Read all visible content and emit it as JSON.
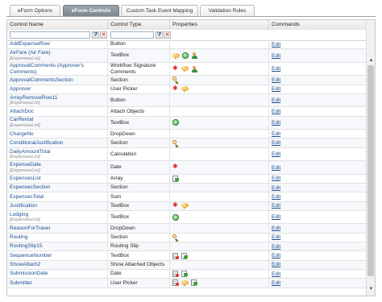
{
  "tabs": [
    {
      "label": "eForm Options",
      "active": false
    },
    {
      "label": "eForm Controls",
      "active": true
    },
    {
      "label": "Custom Task Event Mapping",
      "active": false
    },
    {
      "label": "Validation Rules",
      "active": false
    }
  ],
  "grid": {
    "headers": [
      "Control Name",
      "Control Type",
      "Properties",
      "Commands"
    ],
    "filter": {
      "name_value": "",
      "type_value": ""
    },
    "edit_label": "Edit",
    "rows": [
      {
        "name": "AddExpenseRow",
        "sub": "",
        "type": "Button",
        "icons": []
      },
      {
        "name": "AirFare (Air Fare)",
        "sub": "[ExpensesList]",
        "type": "TextBox",
        "icons": [
          "bubble-icon",
          "globe-icon",
          "person-icon"
        ]
      },
      {
        "name": "ApprovalComments (Approver's Comments)",
        "sub": "",
        "type": "Workflow Signature Comments",
        "icons": [
          "required-star-icon",
          "bubble-icon",
          "person-icon"
        ]
      },
      {
        "name": "ApprovalCommentsSection",
        "sub": "",
        "type": "Section",
        "icons": [
          "magnifier-icon"
        ]
      },
      {
        "name": "Approver",
        "sub": "",
        "type": "User Picker",
        "icons": [
          "required-star-icon",
          "bubble-icon"
        ]
      },
      {
        "name": "ArrayRemoveRow11",
        "sub": "[ExpensesList]",
        "type": "Button",
        "icons": []
      },
      {
        "name": "AttachDoc",
        "sub": "",
        "type": "Attach Objects",
        "icons": []
      },
      {
        "name": "CarRental",
        "sub": "[ExpensesList]",
        "type": "TextBox",
        "icons": [
          "globe-icon"
        ]
      },
      {
        "name": "ChargeNo",
        "sub": "",
        "type": "DropDown",
        "icons": []
      },
      {
        "name": "ConditionalJustification",
        "sub": "",
        "type": "Section",
        "icons": [
          "magnifier-icon"
        ]
      },
      {
        "name": "DailyAmountTotal",
        "sub": "[ExpensesList]",
        "type": "Calculation",
        "icons": []
      },
      {
        "name": "ExpenseDate",
        "sub": "[ExpensesList]",
        "type": "Date",
        "icons": [
          "required-star-icon"
        ]
      },
      {
        "name": "ExpensesList",
        "sub": "",
        "type": "Array",
        "icons": [
          "doc-green-icon"
        ]
      },
      {
        "name": "ExpensesSection",
        "sub": "",
        "type": "Section",
        "icons": []
      },
      {
        "name": "ExpensesTotal",
        "sub": "",
        "type": "Sum",
        "icons": []
      },
      {
        "name": "Justification",
        "sub": "",
        "type": "TextBox",
        "icons": [
          "required-star-icon",
          "bubble-icon"
        ]
      },
      {
        "name": "Lodging",
        "sub": "[ExpensesList]",
        "type": "TextBox",
        "icons": [
          "globe-icon"
        ]
      },
      {
        "name": "ReasonForTravel",
        "sub": "",
        "type": "DropDown",
        "icons": []
      },
      {
        "name": "Routing",
        "sub": "",
        "type": "Section",
        "icons": [
          "magnifier-icon"
        ]
      },
      {
        "name": "RoutingSlip15",
        "sub": "",
        "type": "Routing Slip",
        "icons": []
      },
      {
        "name": "SequenceNumber",
        "sub": "",
        "type": "TextBox",
        "icons": [
          "doc-list-icon",
          "doc-green-icon"
        ]
      },
      {
        "name": "ShowAttach2",
        "sub": "",
        "type": "Show Attached Objects",
        "icons": []
      },
      {
        "name": "SubmissionDate",
        "sub": "",
        "type": "Date",
        "icons": [
          "doc-list-icon",
          "doc-green-icon"
        ]
      },
      {
        "name": "Submitter",
        "sub": "",
        "type": "User Picker",
        "icons": [
          "doc-list-icon",
          "bubble-icon",
          "doc-green-icon"
        ]
      }
    ]
  }
}
